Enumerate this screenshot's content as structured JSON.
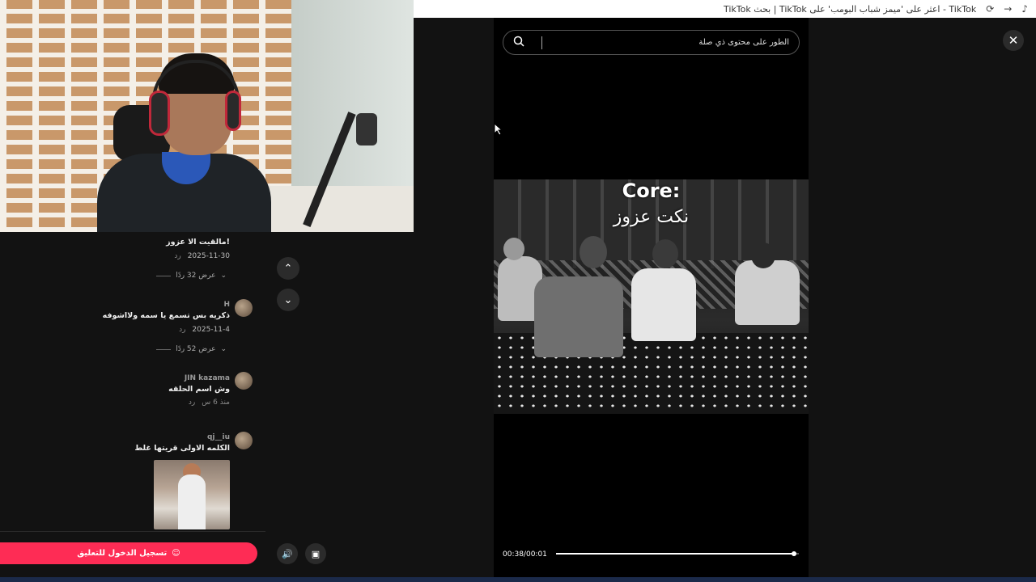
{
  "window": {
    "title": "TikTok بحث | TikTok اعثر على 'ميمز شباب البومب' على - TikTok"
  },
  "search": {
    "placeholder": "الطور على محتوى ذي صلة"
  },
  "video": {
    "overlay_line1": "Core:",
    "overlay_line2": "نكت عزوز",
    "time": "00:38/00:01",
    "progress": 0.98
  },
  "comments": [
    {
      "text": "مالقيت الا عزوز!",
      "date": "2025-11-30",
      "reply": "رد",
      "view_replies": "عرض 32 ردًا"
    },
    {
      "user": "H",
      "text": "ذكريه بس تسمع يا سمه ولااشوفه",
      "date": "2025-11-4",
      "reply": "رد",
      "view_replies": "عرض 52 ردًا"
    },
    {
      "user": "JIN kazama",
      "text": "وش اسم الحلقه",
      "date": "منذ 6 س",
      "reply": "رد"
    },
    {
      "user": "qj__iu",
      "text": "الكلمه الاولى قريتها غلط"
    }
  ],
  "login": {
    "label": "تسجيل الدخول للتعليق"
  },
  "icons": {
    "search": "search-icon",
    "close": "close-icon",
    "up": "chevron-up-icon",
    "down": "chevron-down-icon",
    "volume": "volume-icon",
    "pip": "picture-in-picture-icon"
  },
  "colors": {
    "accent": "#fe2c55",
    "background": "#121212"
  }
}
